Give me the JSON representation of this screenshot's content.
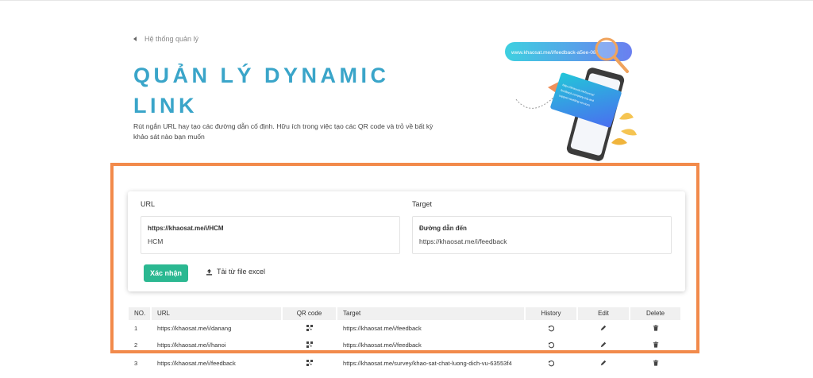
{
  "breadcrumb": {
    "label": "Hệ thống quản lý"
  },
  "page": {
    "title": "QUẢN LÝ DYNAMIC LINK",
    "description": "Rút ngắn URL hay tạo các đường dẫn cố định. Hữu ích trong việc tạo các QR code và trỏ về bất kỳ khảo sát nào bạn muốn"
  },
  "illustration": {
    "pill_text": "www.khaosat.me/i/feedback-a5ee-081",
    "card_text": "https://khaosat.me/survey/ feedback-company-trip-and support-wedding-services-rescued-scan-analysis-a5ee-081"
  },
  "form": {
    "url_section": "URL",
    "target_section": "Target",
    "url_field_label": "https://khaosat.me/i/HCM",
    "url_field_value": "HCM",
    "target_field_label": "Đường dẫn đến",
    "target_field_value": "https://khaosat.me/i/feedback",
    "confirm_label": "Xác nhận",
    "upload_label": "Tải từ file excel"
  },
  "table": {
    "headers": {
      "no": "NO.",
      "url": "URL",
      "qr": "QR code",
      "target": "Target",
      "history": "History",
      "edit": "Edit",
      "delete": "Delete"
    },
    "rows": [
      {
        "no": "1",
        "url": "https://khaosat.me/i/danang",
        "target": "https://khaosat.me/i/feedback"
      },
      {
        "no": "2",
        "url": "https://khaosat.me/i/hanoi",
        "target": "https://khaosat.me/i/feedback"
      },
      {
        "no": "3",
        "url": "https://khaosat.me/i/feedback",
        "target": "https://khaosat.me/survey/khao-sat-chat-luong-dich-vu-63553f4"
      }
    ]
  },
  "colors": {
    "title": "#3aa5c9",
    "confirm": "#2bb891",
    "frame": "#f28a4b"
  }
}
